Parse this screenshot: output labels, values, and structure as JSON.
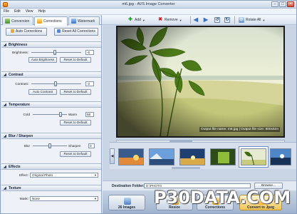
{
  "window": {
    "title": "m6.jpg - AVS Image Converter"
  },
  "menu": [
    "File",
    "Edit",
    "View",
    "Help"
  ],
  "toolbar": {
    "add_label": "Add",
    "remove_label": "Remove",
    "rotate_all_label": "Rotate All"
  },
  "tabs": [
    {
      "label": "Conversion",
      "icon": "conversion-icon"
    },
    {
      "label": "Corrections",
      "icon": "corrections-icon"
    },
    {
      "label": "Watermark",
      "icon": "watermark-icon"
    }
  ],
  "corrections": {
    "auto_corrections_label": "Auto Corrections",
    "reset_all_label": "Reset All Corrections",
    "brightness": {
      "section": "Brightness",
      "label": "Brightness:",
      "value": "-6",
      "level": 0.47,
      "auto_label": "Auto Brightness",
      "reset_label": "Reset to Default"
    },
    "contrast": {
      "section": "Contrast",
      "label": "Contrast:",
      "value": "-2",
      "level": 0.49,
      "auto_label": "Auto Contrast",
      "reset_label": "Reset to Default"
    },
    "temperature": {
      "section": "Temperature",
      "left_label": "Cold",
      "right_label": "Warm",
      "value": "66",
      "level": 0.83,
      "reset_label": "Reset to Default"
    },
    "blur_sharpen": {
      "section": "Blur / Sharpen",
      "left_label": "Blur",
      "right_label": "Sharpen",
      "value": "0",
      "level": 0.5,
      "reset_label": "Reset to Default"
    },
    "effects": {
      "section": "Effects",
      "label": "Effect:",
      "value": "Original Photo"
    },
    "texture": {
      "section": "Texture",
      "label": "Mask:",
      "value": "None"
    }
  },
  "preview": {
    "caption": "Output file name: m6.jpg | Output file size: 800x534"
  },
  "bottom": {
    "destination_label": "Destination Folder:",
    "destination_value": "D:\\PHOTO",
    "browse_label": "Browse...",
    "images_count_label": "26 Images",
    "resize_label": "Resize",
    "corrections_label": "Corrections",
    "convert_label": "Convert to Jpeg"
  },
  "watermark_text": "P30DATA.COM"
}
